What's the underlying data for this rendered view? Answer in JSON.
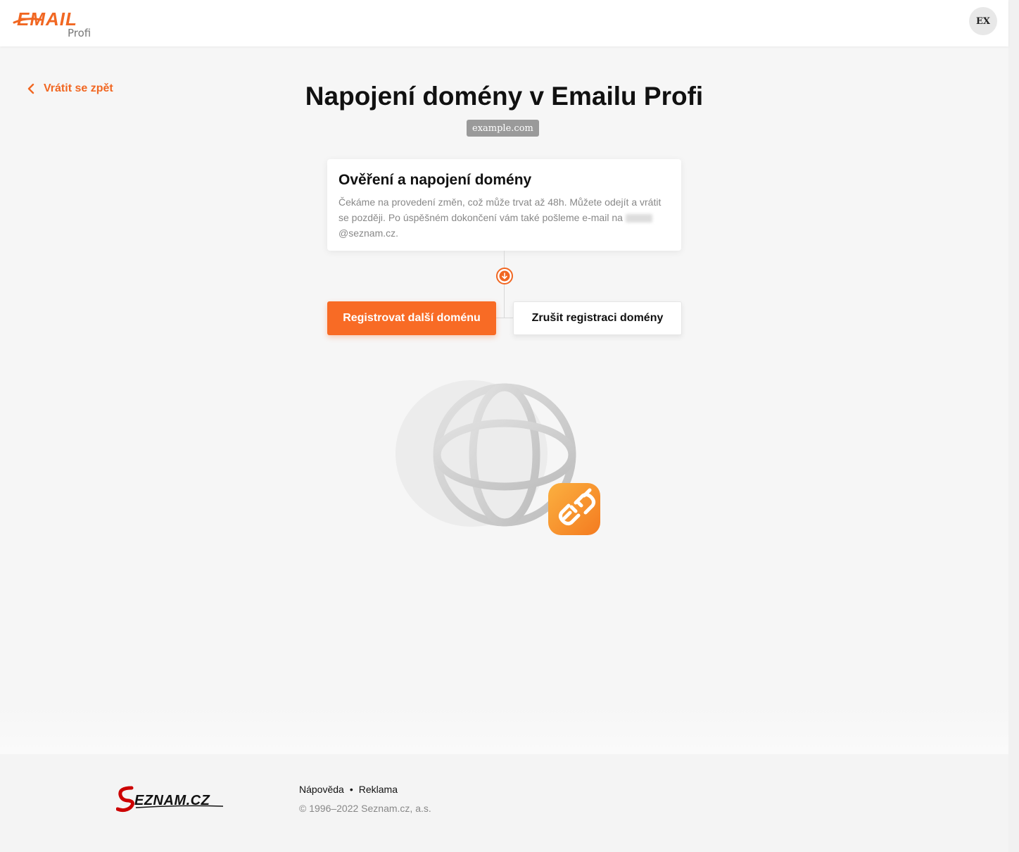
{
  "header": {
    "logo_text_main": "EMAIL",
    "logo_text_sub": "Profi",
    "avatar_initials": "EX"
  },
  "nav": {
    "back_label": "Vrátit se zpět"
  },
  "main": {
    "title": "Napojení domény v Emailu Profi",
    "domain": "example.com",
    "card": {
      "title": "Ověření a napojení domény",
      "text_line": "Čekáme na provedení změn, což může trvat až 48h. Můžete odejít a vrátit se později. Po úspěšném dokončení vám také pošleme e-mail na",
      "email_suffix": "@seznam.cz."
    },
    "buttons": {
      "primary": "Registrovat další doménu",
      "secondary": "Zrušit registraci domény"
    }
  },
  "footer": {
    "logo_text": "Seznam.cz",
    "links": [
      "Nápověda",
      "Reklama"
    ],
    "copyright": "© 1996–2022 Seznam.cz, a.s."
  },
  "colors": {
    "accent": "#f86b25",
    "back_link": "#f16722",
    "badge": "#9a9a9a",
    "link_icon_bg": "#f7941d"
  }
}
